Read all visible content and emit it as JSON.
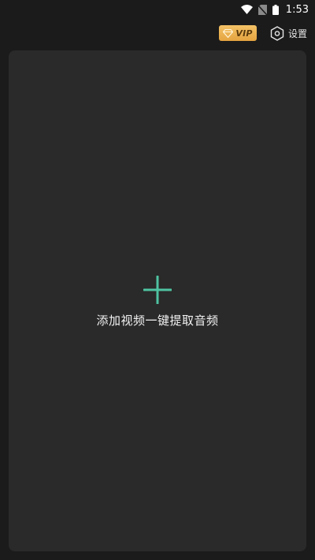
{
  "status_bar": {
    "time": "1:53",
    "icons": [
      "wifi-icon",
      "no-sim-icon",
      "battery-icon"
    ]
  },
  "toolbar": {
    "vip_label": "VIP",
    "vip_icon": "diamond-icon",
    "settings_label": "设置",
    "settings_icon": "hexagon-settings-icon"
  },
  "main": {
    "add_label": "添加视频一键提取音频",
    "add_icon": "plus-icon"
  },
  "colors": {
    "background": "#1b1b1b",
    "card": "#292a29",
    "accent": "#4fc3a1",
    "vip_gold": "#eab04f"
  }
}
